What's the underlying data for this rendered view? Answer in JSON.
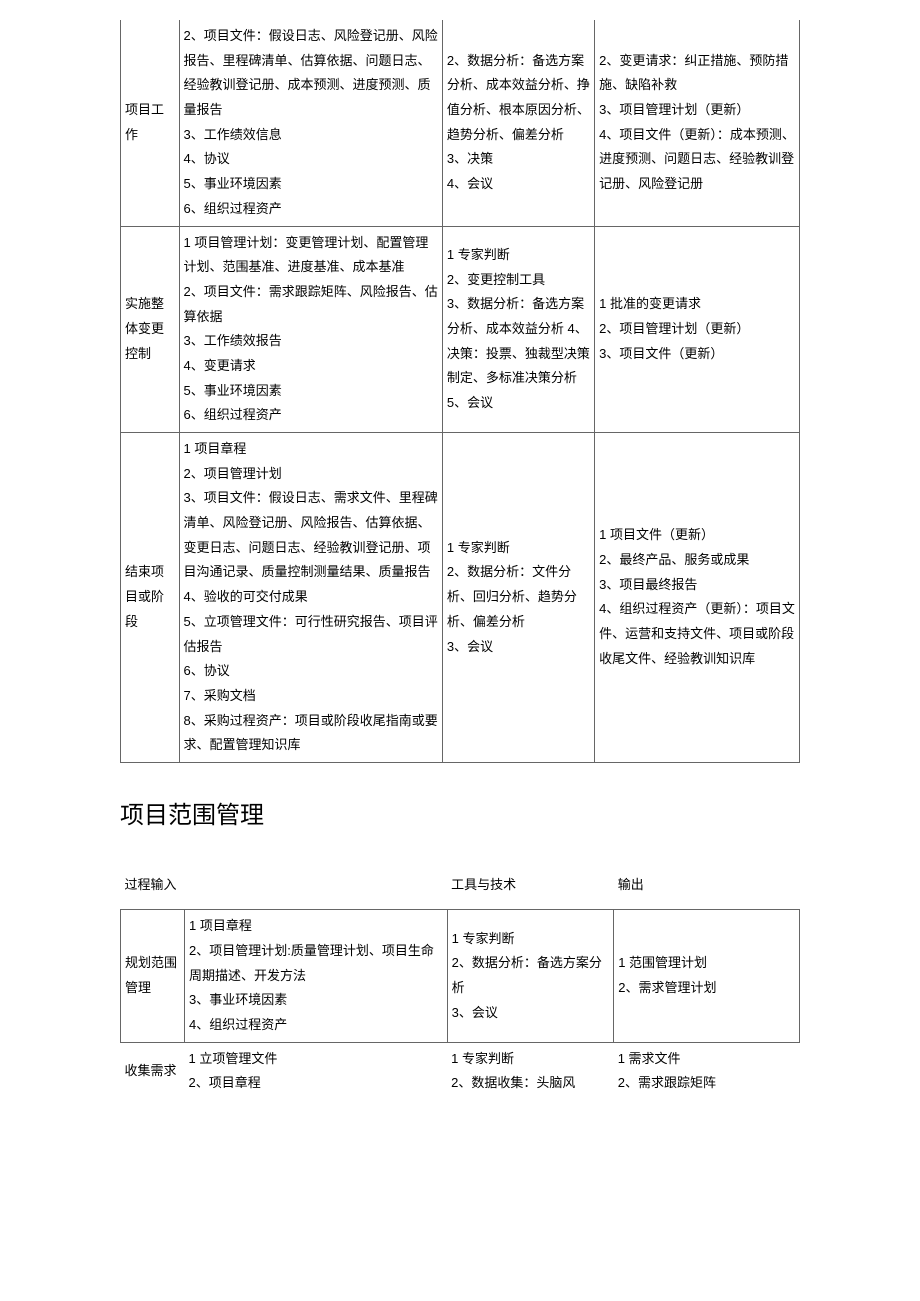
{
  "table1": {
    "rows": [
      {
        "c1": "项目工作",
        "c2": "2、项目文件：假设日志、风险登记册、风险报告、里程碑清单、估算依据、问题日志、经验教训登记册、成本预测、进度预测、质量报告\n3、工作绩效信息\n4、协议\n5、事业环境因素\n6、组织过程资产",
        "c3": "2、数据分析：备选方案分析、成本效益分析、挣值分析、根本原因分析、趋势分析、偏差分析\n3、决策\n4、会议",
        "c4": "2、变更请求：纠正措施、预防措施、缺陷补救\n3、项目管理计划（更新）\n4、项目文件（更新）：成本预测、进度预测、问题日志、经验教训登记册、风险登记册"
      },
      {
        "c1": "实施整体变更控制",
        "c2": "1 项目管理计划：变更管理计划、配置管理计划、范围基准、进度基准、成本基准\n2、项目文件：需求跟踪矩阵、风险报告、估算依据\n3、工作绩效报告\n4、变更请求\n5、事业环境因素\n6、组织过程资产",
        "c3": "1 专家判断\n2、变更控制工具\n3、数据分析：备选方案分析、成本效益分析 4、决策：投票、独裁型决策制定、多标准决策分析\n5、会议",
        "c4": "1 批准的变更请求\n2、项目管理计划（更新）\n3、项目文件（更新）"
      },
      {
        "c1": "结束项目或阶段",
        "c2": "1 项目章程\n2、项目管理计划\n3、项目文件：假设日志、需求文件、里程碑清单、风险登记册、风险报告、估算依据、变更日志、问题日志、经验教训登记册、项目沟通记录、质量控制测量结果、质量报告\n4、验收的可交付成果\n5、立项管理文件：可行性研究报告、项目评估报告\n6、协议\n7、采购文档\n8、采购过程资产：项目或阶段收尾指南或要求、配置管理知识库",
        "c3": "1 专家判断\n2、数据分析：文件分析、回归分析、趋势分析、偏差分析\n3、会议",
        "c4": "1 项目文件（更新）\n2、最终产品、服务或成果\n3、项目最终报告\n4、组织过程资产（更新）：项目文件、运营和支持文件、项目或阶段收尾文件、经验教训知识库"
      }
    ]
  },
  "heading2": "项目范围管理",
  "table2": {
    "header": {
      "c1": "过程",
      "c2": "输入",
      "c3": "工具与技术",
      "c4": "输出"
    },
    "rows": [
      {
        "c1": "规划范围管理",
        "c2": "1 项目章程\n2、项目管理计划:质量管理计划、项目生命周期描述、开发方法\n3、事业环境因素\n4、组织过程资产",
        "c3": "1 专家判断\n2、数据分析：备选方案分析\n3、会议",
        "c4": "1 范围管理计划\n2、需求管理计划"
      },
      {
        "c1": "收集需求",
        "c2": "1 立项管理文件\n2、项目章程",
        "c3": "1 专家判断\n2、数据收集：头脑风",
        "c4": "1 需求文件\n2、需求跟踪矩阵"
      }
    ]
  }
}
